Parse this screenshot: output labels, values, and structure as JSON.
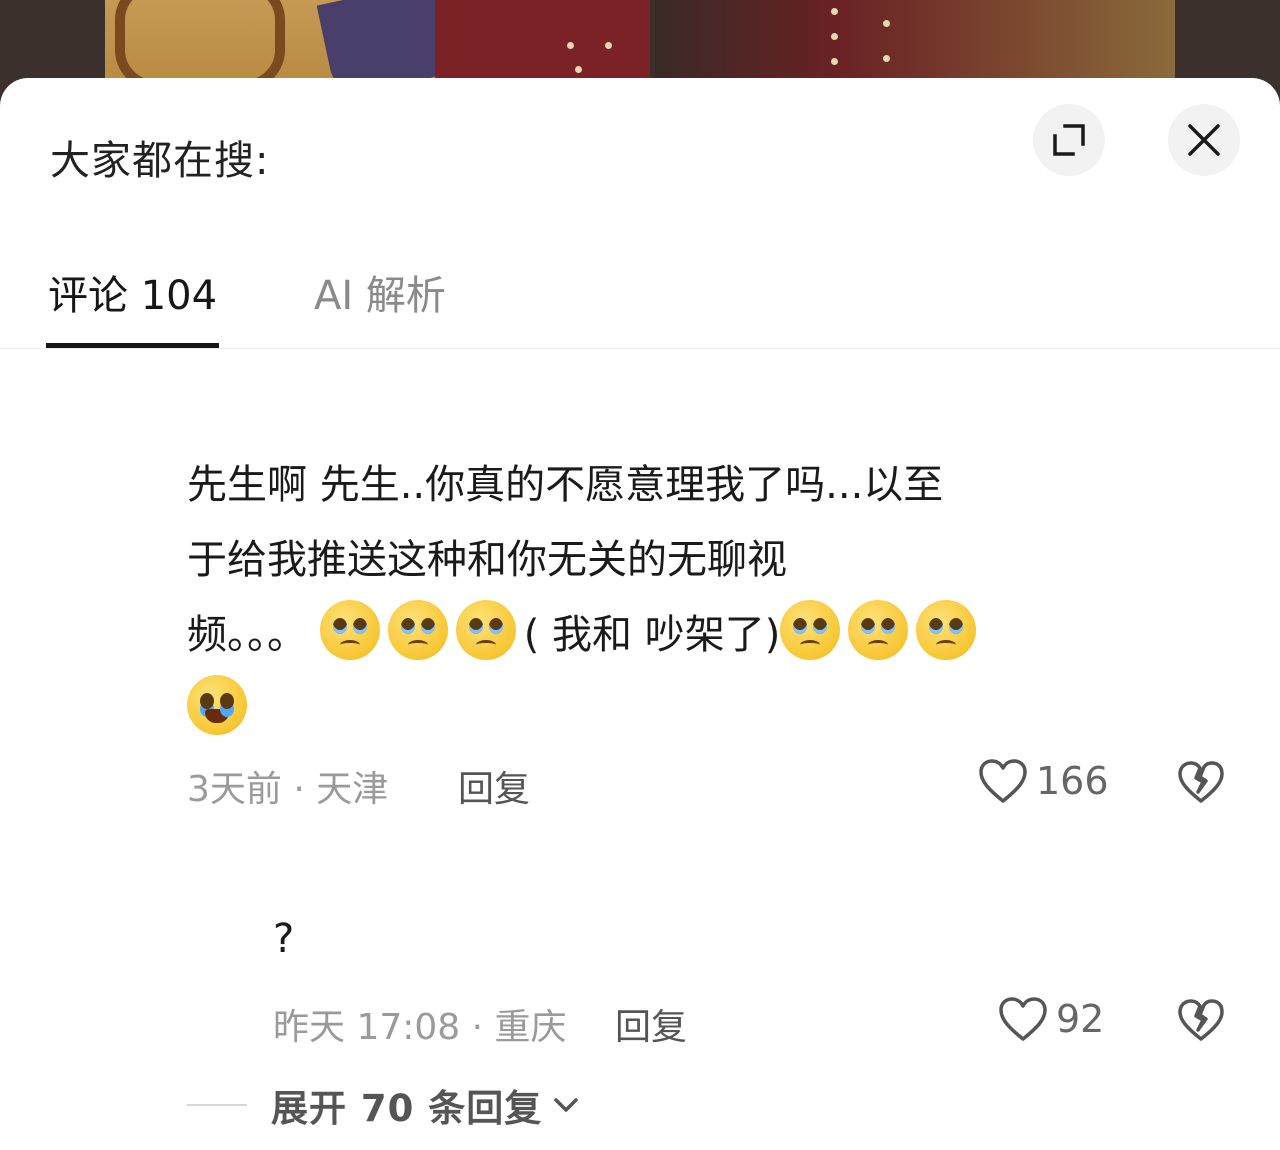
{
  "header": {
    "search_prompt": "大家都在搜:",
    "expand_icon": "expand-icon",
    "close_icon": "close-icon"
  },
  "tabs": [
    {
      "label": "评论 104",
      "active": true
    },
    {
      "label": "AI 解析",
      "active": false
    }
  ],
  "comment": {
    "lines": [
      "  先生啊    先生..你真的不愿意理我了吗...以至",
      "于给我推送这种和你无关的无聊视",
      "频。。。"
    ],
    "inline_text": "(    我和        吵架了)",
    "meta": "3天前 · 天津",
    "reply_label": "回复",
    "likes": "166"
  },
  "reply": {
    "text": "?",
    "meta": "昨天 17:08 · 重庆",
    "reply_label": "回复",
    "likes": "92"
  },
  "expand_replies": {
    "label": "展开 70 条回复"
  },
  "colors": {
    "tab_active": "#161616",
    "tab_inactive": "#8a8a8a",
    "meta_text": "#9a9a9a",
    "sheet_bg": "#ffffff"
  }
}
